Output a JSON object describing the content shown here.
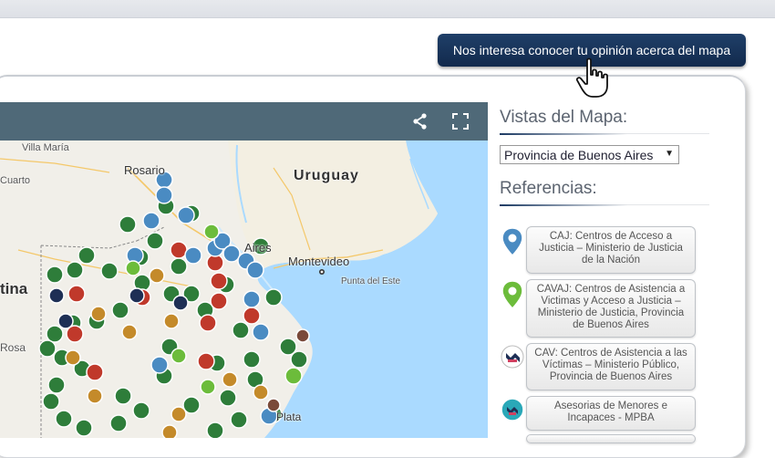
{
  "feedback_button": "Nos interesa conocer tu opinión acerca del mapa",
  "toolbar": {
    "share_icon": "share-icon",
    "fullscreen_icon": "fullscreen-icon"
  },
  "map_labels": {
    "villa_maria": "Villa María",
    "cuarto": "Cuarto",
    "rosario": "Rosario",
    "uruguay": "Uruguay",
    "aires": "Aires",
    "montevideo": "Montevideo",
    "punta_del_este": "Punta del Este",
    "tina": "tina",
    "rosa": "Rosa",
    "plata": "Plata"
  },
  "sidebar": {
    "views_title": "Vistas del Mapa:",
    "province_select": "Provincia de Buenos Aires",
    "references_title": "Referencias:",
    "references": [
      {
        "icon": "caj-pin-icon",
        "color": "#4a8bc2",
        "label": "CAJ: Centros de Acceso a Justicia – Ministerio de Justicia de la Nación"
      },
      {
        "icon": "cavaj-pin-icon",
        "color": "#6cbc3b",
        "label": "CAVAJ: Centros de Asistencia a Victimas y Acceso a Justicia – Ministerio de Justicia, Provincia de Buenos Aires"
      },
      {
        "icon": "cav-badge-icon",
        "color": "#1e2f55",
        "label": "CAV: Centros de Asistencia a las Víctimas – Ministerio Público, Provincia de Buenos Aires"
      },
      {
        "icon": "asesorias-badge-icon",
        "color": "#2aa8b8",
        "label": "Asesorias de Menores e Incapaces - MPBA"
      }
    ]
  },
  "colors": {
    "toolbar": "#4f6978",
    "button": "#1a355b",
    "water": "#aadaff",
    "land": "#f1efe9",
    "marker_green": "#2e7d3a",
    "marker_red": "#c0392b",
    "marker_blue": "#4a8bc2"
  }
}
